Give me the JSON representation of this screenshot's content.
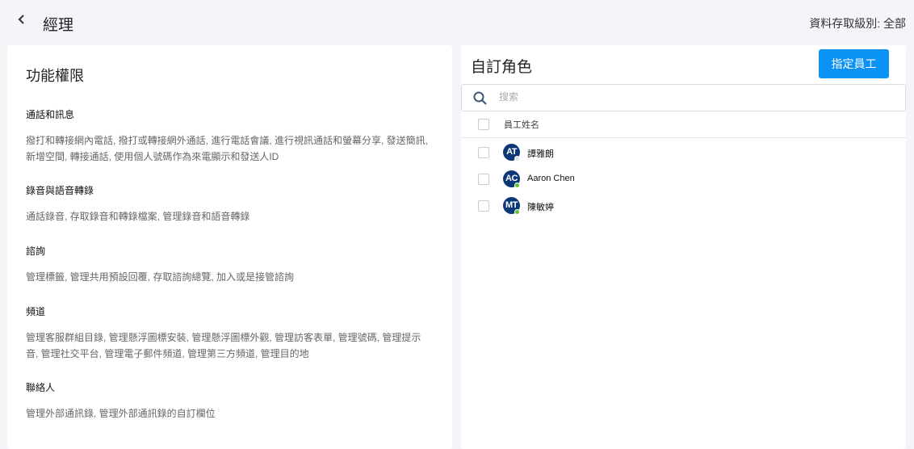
{
  "header": {
    "title": "經理",
    "access_level": "資料存取級別: 全部"
  },
  "permissions": {
    "title": "功能權限",
    "sections": [
      {
        "title": "通話和訊息",
        "desc": "撥打和轉接網內電話, 撥打或轉接網外通話, 進行電話會議, 進行視訊通話和螢幕分享, 發送簡訊, 新增空間, 轉接通話, 使用個人號碼作為來電顯示和發送人ID"
      },
      {
        "title": "錄音與語音轉錄",
        "desc": "通話錄音, 存取錄音和轉錄檔案, 管理錄音和語音轉錄"
      },
      {
        "title": "諮詢",
        "desc": "管理標籤, 管理共用預設回覆, 存取諮詢總覽, 加入或是接管諮詢"
      },
      {
        "title": "頻道",
        "desc": "管理客服群組目錄, 管理懸浮圖標安裝, 管理懸浮圖標外觀, 管理訪客表單, 管理號碼, 管理提示音, 管理社交平台, 管理電子郵件頻道, 管理第三方頻道, 管理目的地"
      },
      {
        "title": "聯絡人",
        "desc": "管理外部通訊錄, 管理外部通訊錄的自訂欄位"
      }
    ]
  },
  "role": {
    "title": "自訂角色",
    "assign_button": "指定員工",
    "search_placeholder": "搜索",
    "column_header": "員工姓名",
    "employees": [
      {
        "initials": "AT",
        "name": "譚雅朗",
        "status_color": "#dcdfe6"
      },
      {
        "initials": "AC",
        "name": "Aaron Chen",
        "status_color": "#5ac72a"
      },
      {
        "initials": "MT",
        "name": "陳敏婷",
        "status_color": "#5ac72a"
      }
    ]
  }
}
